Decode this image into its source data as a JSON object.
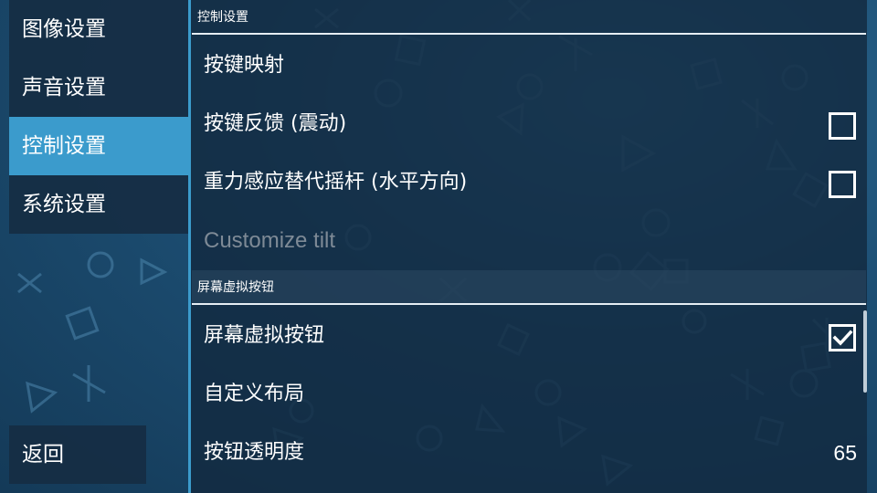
{
  "sidebar": {
    "items": [
      {
        "label": "图像设置",
        "active": false
      },
      {
        "label": "声音设置",
        "active": false
      },
      {
        "label": "控制设置",
        "active": true
      },
      {
        "label": "系统设置",
        "active": false
      }
    ],
    "back_label": "返回"
  },
  "sections": [
    {
      "header": "控制设置",
      "rows": [
        {
          "label": "按键映射"
        },
        {
          "label": "按键反馈 (震动)",
          "checked": false
        },
        {
          "label": "重力感应替代摇杆 (水平方向)",
          "checked": false
        },
        {
          "label": "Customize tilt",
          "disabled": true
        }
      ]
    },
    {
      "header": "屏幕虚拟按钮",
      "rows": [
        {
          "label": "屏幕虚拟按钮",
          "checked": true
        },
        {
          "label": "自定义布局"
        },
        {
          "label": "按钮透明度",
          "value": "65"
        }
      ]
    }
  ],
  "colors": {
    "accent": "#3b9bcc",
    "background": "#1d4f74"
  }
}
